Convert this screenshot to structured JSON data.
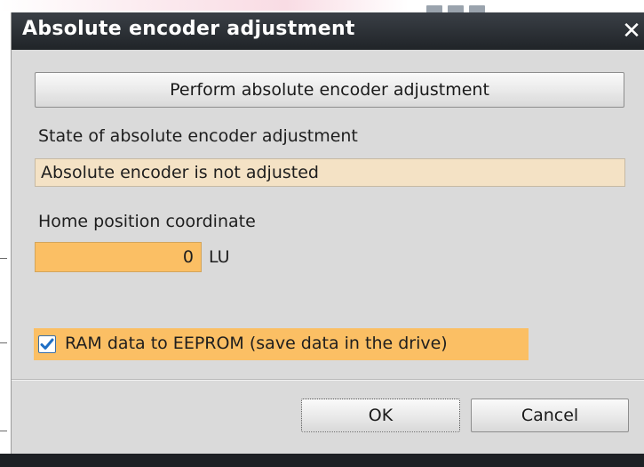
{
  "dialog": {
    "title": "Absolute encoder adjustment",
    "close_icon": "close-icon",
    "perform_button_label": "Perform absolute encoder adjustment",
    "state_label": "State of absolute encoder adjustment",
    "state_value": "Absolute encoder is not adjusted",
    "home_label": "Home position coordinate",
    "home_value": "0",
    "home_unit": "LU",
    "ram_checkbox_label": "RAM data to EEPROM (save data in the drive)",
    "ram_checkbox_checked": true,
    "ok_label": "OK",
    "cancel_label": "Cancel"
  },
  "colors": {
    "title_bar": "#2b2f34",
    "dialog_bg": "#dadada",
    "readonly_field": "#f4e2c5",
    "highlight_orange": "#fbbf64",
    "checkbox_check": "#1f6fc5"
  }
}
